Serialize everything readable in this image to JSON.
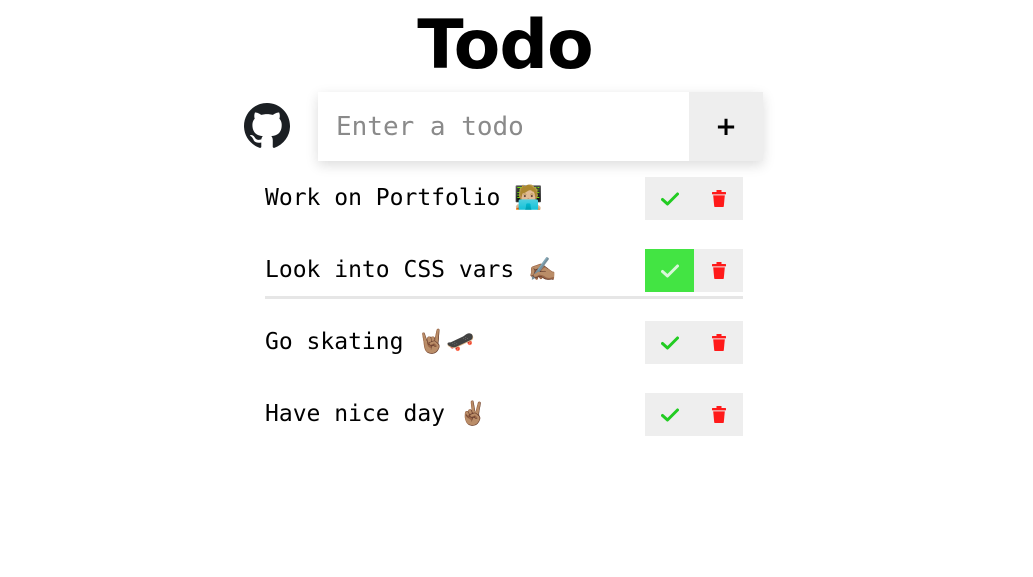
{
  "app": {
    "title": "Todo"
  },
  "form": {
    "placeholder": "Enter a todo",
    "add_label": "+"
  },
  "icons": {
    "github": "github-icon",
    "complete": "check-icon",
    "delete": "trash-icon"
  },
  "colors": {
    "check": "#22cc22",
    "check_active_bg": "#43e443",
    "delete": "#ff1a1a",
    "button_bg": "#eeeeee"
  },
  "todos": [
    {
      "text": "Work on Portfolio 🧑🏼‍💻",
      "completed": false
    },
    {
      "text": "Look into CSS vars ✍🏽",
      "completed": true
    },
    {
      "text": "Go skating 🤘🏽🛹",
      "completed": false
    },
    {
      "text": "Have nice day ✌🏽",
      "completed": false
    }
  ]
}
